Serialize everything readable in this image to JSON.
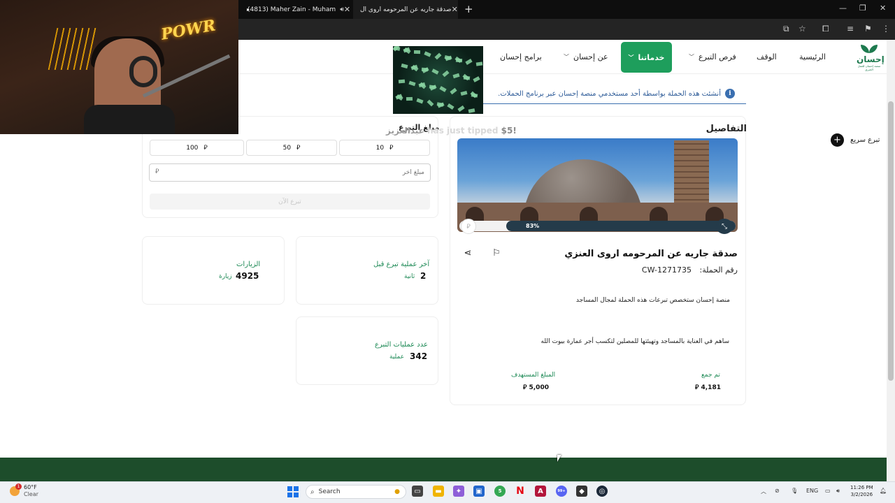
{
  "browser": {
    "tabs": [
      {
        "title": "(4813) Maher Zain - Muham",
        "icon": "youtube-icon"
      },
      {
        "title": "صدقة جاريه عن المرحومه اروى ال",
        "icon": "site-favicon"
      }
    ],
    "new_tab": "+",
    "win_min": "—",
    "win_max": "❐",
    "win_close": "✕"
  },
  "overlay": {
    "tip_text": "has just tipped ",
    "tip_amount": "$5!",
    "tip_name": "عبدالعزيز"
  },
  "site": {
    "logo_text": "إحسان",
    "logo_sub": "منصة إحسان للعمل الخيري",
    "nav": {
      "home": "الرئيسية",
      "waqf": "الوقف",
      "opportunities": "فرص التبرع",
      "services": "خدماتنا",
      "about": "عن إحسان",
      "programs": "برامج إحسان"
    },
    "banner": "أنشئت هذه الحملة بواسطة أحد مستخدمي منصة إحسان عبر برنامج الحملات.",
    "quick_donate": "تبرع سريع",
    "details": {
      "title": "التفاصيل",
      "progress_percent": 83,
      "progress_label": "83%",
      "campaign_name": "صدقة جاريه عن المرحومه اروى العنزي",
      "campaign_code_label": "رقم الحملة:",
      "campaign_code": "CW-1271735",
      "desc1": "منصة إحسان ستخصص تبرعات هذه الحملة لمجال المساجد",
      "desc2": "ساهم في العناية بالمساجد وتهيئتها للمصلين لتكسب أجر عمارة بيوت الله",
      "collected_label": "تم جمع",
      "collected_value": "4,181",
      "target_label": "المبلغ المستهدف",
      "target_value": "5,000",
      "currency": "⃁"
    },
    "donation": {
      "title": "مبلغ التبرع",
      "amounts": [
        "10",
        "50",
        "100"
      ],
      "other_placeholder": "مبلغ آخر",
      "donate_now": "تبرع الآن"
    },
    "stats": {
      "last_donation_label": "آخر عملية تبرع قبل",
      "last_donation_value": "2",
      "last_donation_unit": "ثانية",
      "visits_label": "الزيارات",
      "visits_value": "4925",
      "visits_unit": "زيارة",
      "ops_label": "عدد عمليات التبرع",
      "ops_value": "342",
      "ops_unit": "عملية"
    }
  },
  "taskbar": {
    "weather_temp": "60°F",
    "weather_desc": "Clear",
    "weather_badge": "1",
    "search": "Search",
    "lang": "ENG",
    "time": "11:26 PM",
    "date": "3/2/2026",
    "badge_5": "5",
    "badge_99": "99+"
  },
  "colors": {
    "brand_green": "#1e7a4f",
    "active_nav": "#1e9e5c",
    "footer": "#1d4d2b",
    "progress": "#243b4a"
  }
}
